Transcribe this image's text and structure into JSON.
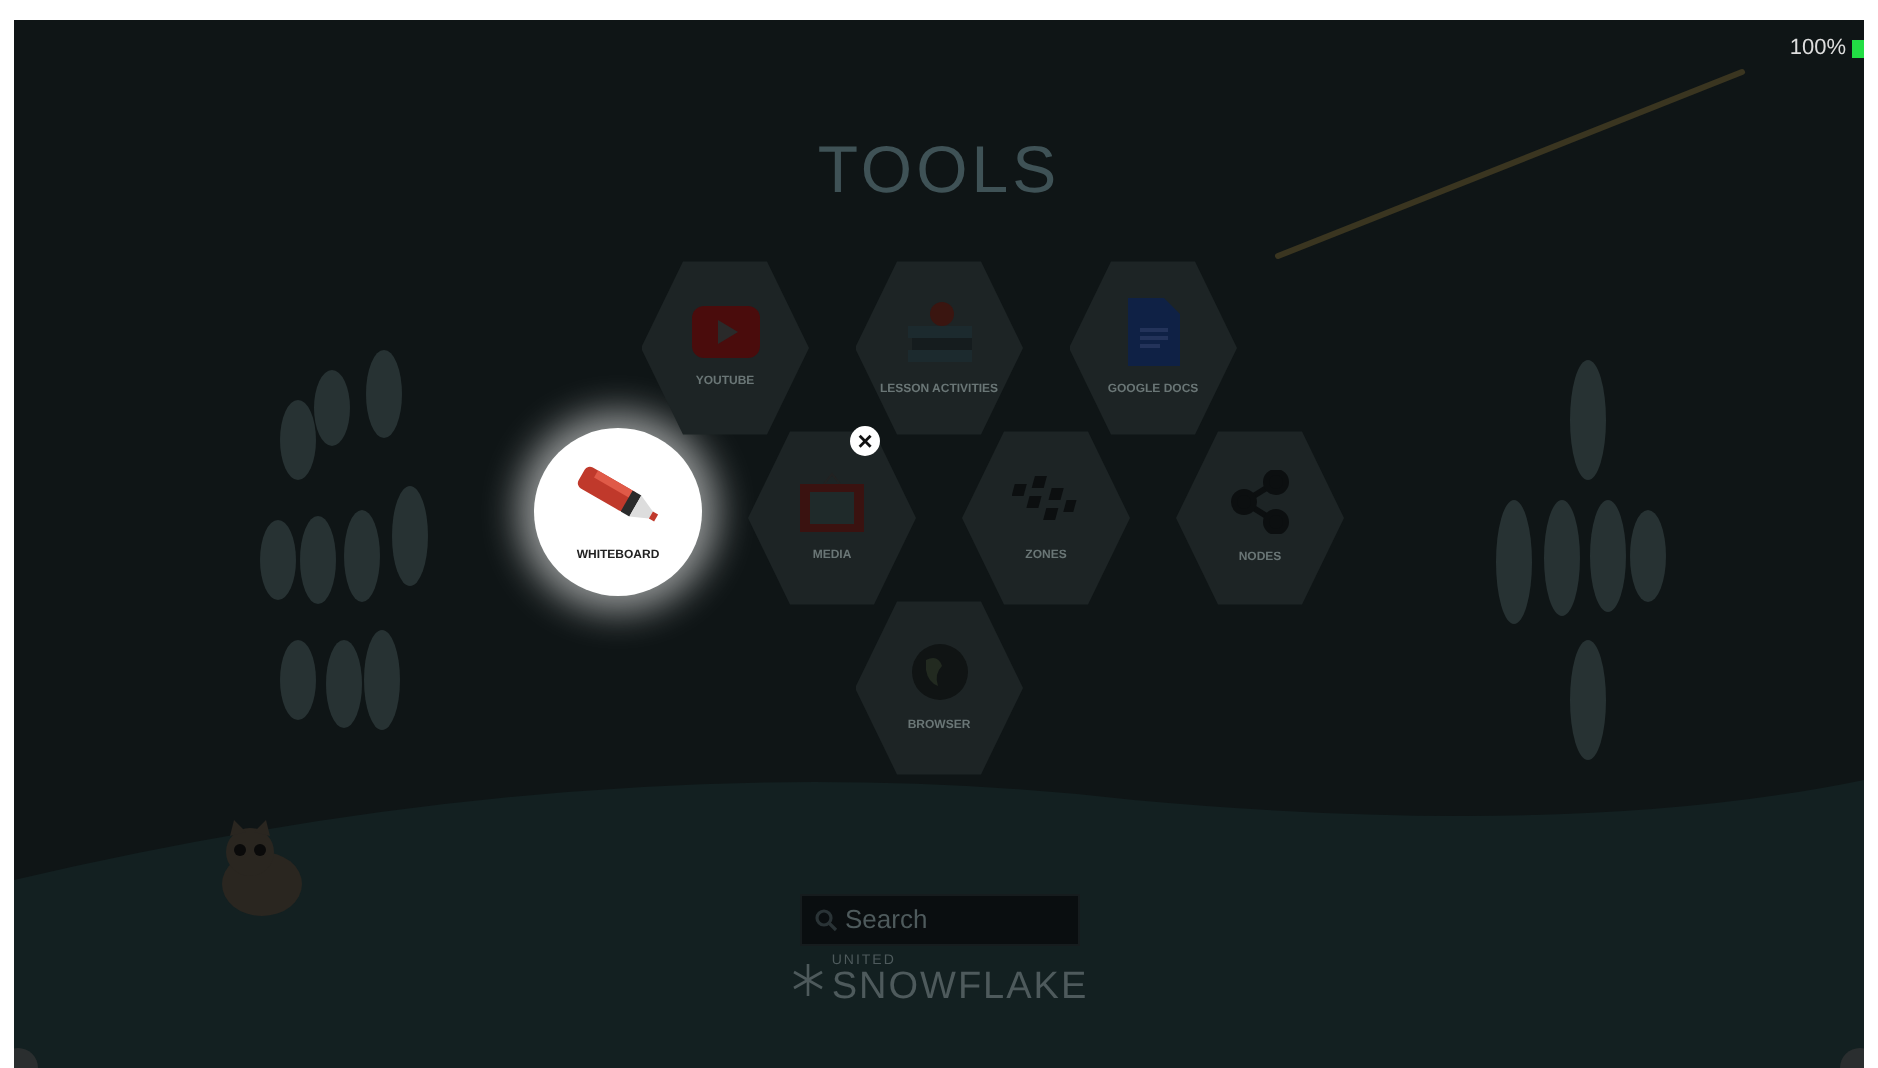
{
  "battery": {
    "reading": "100%"
  },
  "title": "TOOLS",
  "tools": [
    {
      "label": "YOUTUBE",
      "kind": "video",
      "selected": false
    },
    {
      "label": "LESSON ACTIVITIES",
      "kind": "books",
      "selected": false
    },
    {
      "label": "GOOGLE DOCS",
      "kind": "document",
      "selected": false
    },
    {
      "label": "WHITEBOARD",
      "kind": "marker",
      "selected": true
    },
    {
      "label": "MEDIA",
      "kind": "tv",
      "selected": false
    },
    {
      "label": "ZONES",
      "kind": "tiles",
      "selected": false
    },
    {
      "label": "NODES",
      "kind": "share",
      "selected": false
    },
    {
      "label": "BROWSER",
      "kind": "globe",
      "selected": false
    }
  ],
  "close": "×",
  "search": {
    "placeholder": "Search"
  },
  "logo": {
    "top": "UNITED",
    "bottom": "SNOWFLAKE"
  }
}
